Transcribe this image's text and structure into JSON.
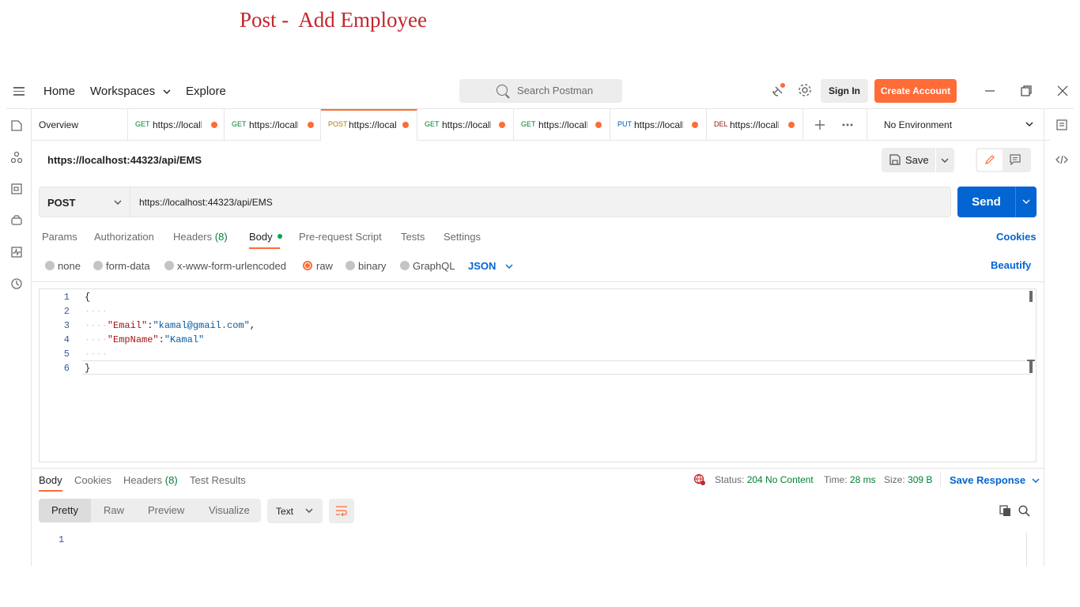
{
  "slide_title": "Post -  Add Employee",
  "header": {
    "nav": [
      "Home",
      "Workspaces",
      "Explore"
    ],
    "search_placeholder": "Search Postman",
    "sign_in": "Sign In",
    "create_account": "Create Account"
  },
  "tabs": [
    {
      "label": "Overview"
    },
    {
      "method": "GET",
      "url": "https://localh"
    },
    {
      "method": "GET",
      "url": "https://localh"
    },
    {
      "method": "POST",
      "url": "https://local"
    },
    {
      "method": "GET",
      "url": "https://localh"
    },
    {
      "method": "GET",
      "url": "https://localh"
    },
    {
      "method": "PUT",
      "url": "https://localh"
    },
    {
      "method": "DEL",
      "url": "https://localh"
    }
  ],
  "environment": "No Environment",
  "request": {
    "title": "https://localhost:44323/api/EMS",
    "save": "Save",
    "method": "POST",
    "url": "https://localhost:44323/api/EMS",
    "send": "Send",
    "tabs": [
      "Params",
      "Authorization",
      "Headers",
      "(8)",
      "Body",
      "Pre-request Script",
      "Tests",
      "Settings"
    ],
    "cookies": "Cookies",
    "body_types": [
      "none",
      "form-data",
      "x-www-form-urlencoded",
      "raw",
      "binary",
      "GraphQL"
    ],
    "format": "JSON",
    "beautify": "Beautify",
    "line_numbers": [
      "1",
      "2",
      "3",
      "4",
      "5",
      "6"
    ],
    "code": {
      "l1": "{",
      "dots": "····",
      "key1": "\"Email\"",
      "val1": "\"kamal@gmail.com\"",
      "key2": "\"EmpName\"",
      "val2": "\"Kamal\"",
      "l6": "}"
    }
  },
  "response": {
    "tabs": [
      "Body",
      "Cookies",
      "Headers",
      "(8)",
      "Test Results"
    ],
    "status_label": "Status:",
    "status_value": "204 No Content",
    "time_label": "Time:",
    "time_value": "28 ms",
    "size_label": "Size:",
    "size_value": "309 B",
    "save_response": "Save Response",
    "views": [
      "Pretty",
      "Raw",
      "Preview",
      "Visualize"
    ],
    "text_type": "Text",
    "line1": "1"
  },
  "colors": {
    "accent": "#ff6c37",
    "send": "#0265d2",
    "status_ok": "#007f31",
    "slide_title": "#c0272d"
  }
}
